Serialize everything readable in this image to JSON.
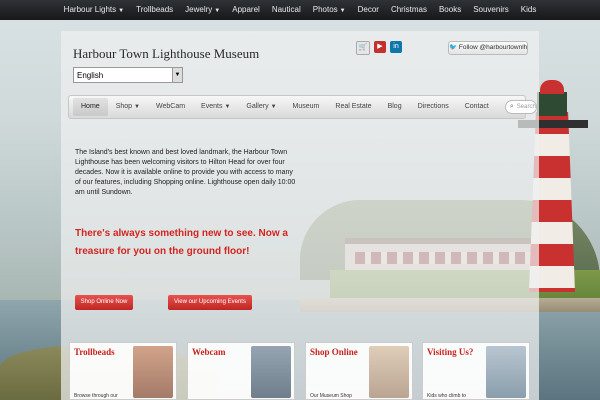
{
  "top_nav": {
    "items": [
      {
        "label": "Harbour Lights",
        "dropdown": true
      },
      {
        "label": "Trollbeads",
        "dropdown": false
      },
      {
        "label": "Jewelry",
        "dropdown": true
      },
      {
        "label": "Apparel",
        "dropdown": false
      },
      {
        "label": "Nautical",
        "dropdown": false
      },
      {
        "label": "Photos",
        "dropdown": true
      },
      {
        "label": "Decor",
        "dropdown": false
      },
      {
        "label": "Christmas",
        "dropdown": false
      },
      {
        "label": "Books",
        "dropdown": false
      },
      {
        "label": "Souvenirs",
        "dropdown": false
      },
      {
        "label": "Kids",
        "dropdown": false
      }
    ]
  },
  "header": {
    "title": "Harbour Town Lighthouse Museum",
    "social_icons": [
      "cart-icon",
      "youtube-icon",
      "linkedin-icon"
    ],
    "follow_label": "Follow @harbourtownlh",
    "language_selected": "English"
  },
  "main_nav": {
    "items": [
      {
        "label": "Home",
        "active": true,
        "dropdown": false
      },
      {
        "label": "Shop",
        "active": false,
        "dropdown": true
      },
      {
        "label": "WebCam",
        "active": false,
        "dropdown": false
      },
      {
        "label": "Events",
        "active": false,
        "dropdown": true
      },
      {
        "label": "Gallery",
        "active": false,
        "dropdown": true
      },
      {
        "label": "Museum",
        "active": false,
        "dropdown": false
      },
      {
        "label": "Real Estate",
        "active": false,
        "dropdown": false
      },
      {
        "label": "Blog",
        "active": false,
        "dropdown": false
      },
      {
        "label": "Directions",
        "active": false,
        "dropdown": false
      },
      {
        "label": "Contact",
        "active": false,
        "dropdown": false
      }
    ],
    "search_placeholder": "Search"
  },
  "content": {
    "intro": "The Island's best known and best loved landmark, the Harbour Town Lighthouse has been welcoming visitors to Hilton Head for over four decades.  Now it is available online to provide you with access to many of our features, including Shopping online. Lighthouse open daily 10:00 am until Sundown.",
    "promo": "There's always something new to see. Now a treasure for you on the ground floor!",
    "button_shop": "Shop Online Now",
    "button_events": "View our Upcoming Events"
  },
  "boxes": [
    {
      "title": "Trollbeads",
      "text": "Browse through our"
    },
    {
      "title": "Webcam",
      "text": ""
    },
    {
      "title": "Shop Online",
      "text": "Our Museum Shop"
    },
    {
      "title": "Visiting Us?",
      "text": "Kids who climb to"
    }
  ],
  "colors": {
    "accent_red": "#d52420",
    "topbar": "#1f2124"
  }
}
